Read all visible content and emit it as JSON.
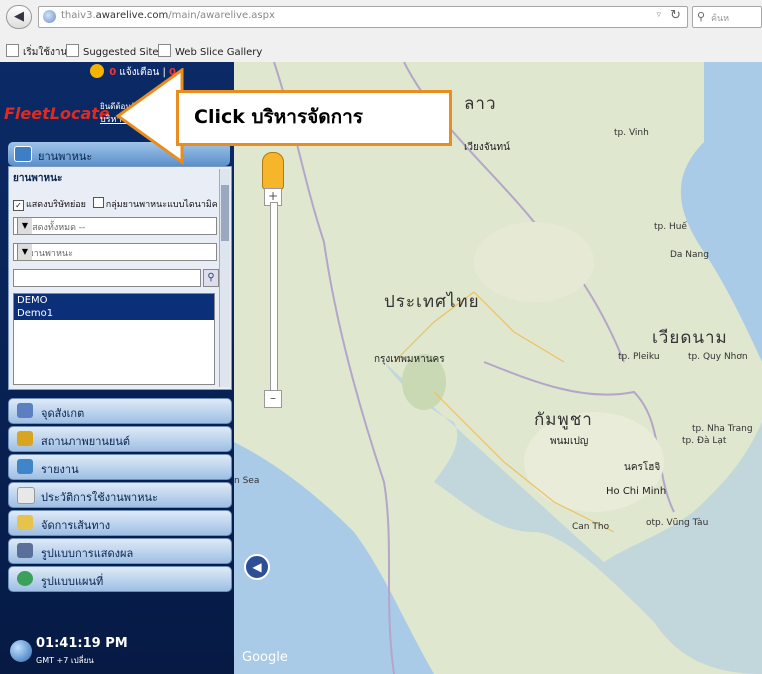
{
  "browser": {
    "url_host": "thaiv3.",
    "url_domain": "awarelive.com",
    "url_path": "/main/awarelive.aspx",
    "search_placeholder": "ค้นห",
    "bookmarks": [
      "เริ่มใช้งาน",
      "Suggested Sites",
      "Web Slice Gallery"
    ]
  },
  "sidebar": {
    "alert_count": "0",
    "alert_label": "แจ้งเตือน |",
    "alert_count2": "0",
    "logo": "FleetLocate",
    "welcome": "ยินดีต้อนรับ",
    "admin_link": "บริหารจัดการ",
    "section_title": "ยานพาหนะ",
    "panel_title": "ยานพาหนะ",
    "show_subcompany": "แสดงบริษัทย่อย",
    "group_label": "กลุ่มยานพาหนะแบบไดนามิค",
    "select_all": "-- แสดงทั้งหมด --",
    "select_vehicle": "ชื่อยานพาหนะ",
    "vehicles": [
      "DEMO",
      "Demo1"
    ],
    "menu": [
      "จุดสังเกต",
      "สถานภาพยานยนต์",
      "รายงาน",
      "ประวัติการใช้งานพาหนะ",
      "จัดการเส้นทาง",
      "รูปแบบการแสดงผล",
      "รูปแบบแผนที่"
    ],
    "clock_time": "01:41:19 PM",
    "clock_zone": "GMT +7 เปลี่ยน"
  },
  "callout": {
    "prefix": "Click",
    "text": "บริหารจัดการ",
    "color": "#e88d1e"
  },
  "map": {
    "labels": {
      "laos": "ลาว",
      "thailand": "ประเทศไทย",
      "cambodia": "กัมพูชา",
      "vietnam": "เวียดนาม",
      "bangkok": "กรุงเทพมหานคร",
      "vientiane": "เวียงจันทน์",
      "phnom_penh": "พนมเปญ",
      "hcm": "Ho Chi Minh",
      "hcm_th": "นครโฮจิ",
      "vinh": "tp. Vinh",
      "hue": "tp. Huế",
      "danang": "Da Nang",
      "pleiku": "tp. Pleiku",
      "quynhon": "tp. Quy Nhơn",
      "nhatrang": "tp. Nha Trang",
      "dalat": "tp. Đà Lạt",
      "cantho": "Can Tho",
      "vungtau": "otp. Vũng Tàu",
      "sea": "n Sea",
      "google": "Google"
    }
  }
}
